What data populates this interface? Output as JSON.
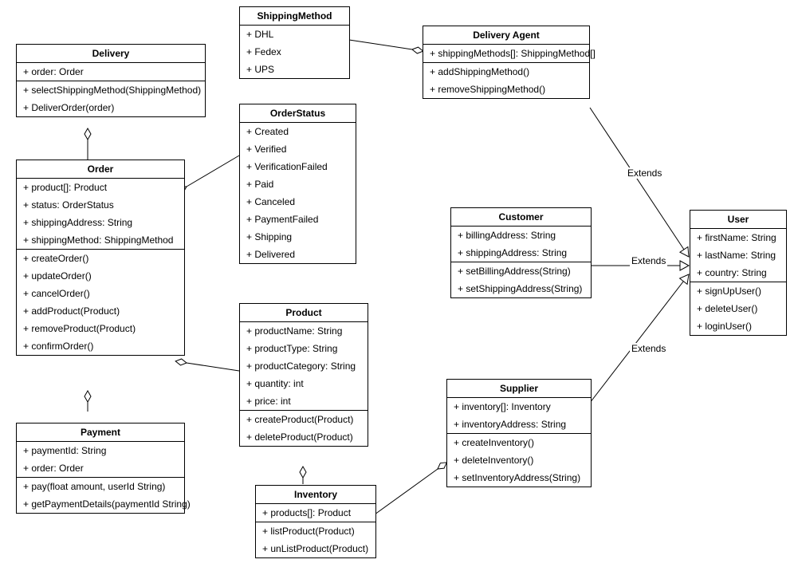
{
  "classes": {
    "shippingMethod": {
      "title": "ShippingMethod",
      "attrs": [
        "+ DHL",
        "+ Fedex",
        "+ UPS"
      ]
    },
    "delivery": {
      "title": "Delivery",
      "attrs": [
        "+ order: Order"
      ],
      "methods": [
        "+ selectShippingMethod(ShippingMethod)",
        "+ DeliverOrder(order)"
      ]
    },
    "deliveryAgent": {
      "title": "Delivery Agent",
      "attrs": [
        "+ shippingMethods[]: ShippingMethod[]"
      ],
      "methods": [
        "+ addShippingMethod()",
        "+ removeShippingMethod()"
      ]
    },
    "orderStatus": {
      "title": "OrderStatus",
      "attrs": [
        "+ Created",
        "+ Verified",
        "+ VerificationFailed",
        "+ Paid",
        "+ Canceled",
        "+ PaymentFailed",
        "+ Shipping",
        "+ Delivered"
      ]
    },
    "order": {
      "title": "Order",
      "attrs": [
        "+ product[]: Product",
        "+ status: OrderStatus",
        "+ shippingAddress: String",
        "+ shippingMethod: ShippingMethod"
      ],
      "methods": [
        "+ createOrder()",
        "+ updateOrder()",
        "+ cancelOrder()",
        "+ addProduct(Product)",
        "+ removeProduct(Product)",
        "+ confirmOrder()"
      ]
    },
    "customer": {
      "title": "Customer",
      "attrs": [
        "+ billingAddress: String",
        "+ shippingAddress: String"
      ],
      "methods": [
        "+ setBillingAddress(String)",
        "+ setShippingAddress(String)"
      ]
    },
    "user": {
      "title": "User",
      "attrs": [
        "+ firstName: String",
        "+ lastName: String",
        "+ country: String"
      ],
      "methods": [
        "+ signUpUser()",
        "+ deleteUser()",
        "+ loginUser()"
      ]
    },
    "product": {
      "title": "Product",
      "attrs": [
        "+ productName: String",
        "+ productType: String",
        "+ productCategory: String",
        "+ quantity: int",
        "+ price: int"
      ],
      "methods": [
        "+ createProduct(Product)",
        "+ deleteProduct(Product)"
      ]
    },
    "payment": {
      "title": "Payment",
      "attrs": [
        "+ paymentId: String",
        "+ order: Order"
      ],
      "methods": [
        "+ pay(float amount, userId String)",
        "+ getPaymentDetails(paymentId String)"
      ]
    },
    "supplier": {
      "title": "Supplier",
      "attrs": [
        "+ inventory[]: Inventory",
        "+ inventoryAddress: String"
      ],
      "methods": [
        "+ createInventory()",
        "+ deleteInventory()",
        "+ setInventoryAddress(String)"
      ]
    },
    "inventory": {
      "title": "Inventory",
      "attrs": [
        "+ products[]: Product"
      ],
      "methods": [
        "+ listProduct(Product)",
        "+ unListProduct(Product)"
      ]
    }
  },
  "edgeLabels": {
    "extends1": "Extends",
    "extends2": "Extends",
    "extends3": "Extends"
  }
}
